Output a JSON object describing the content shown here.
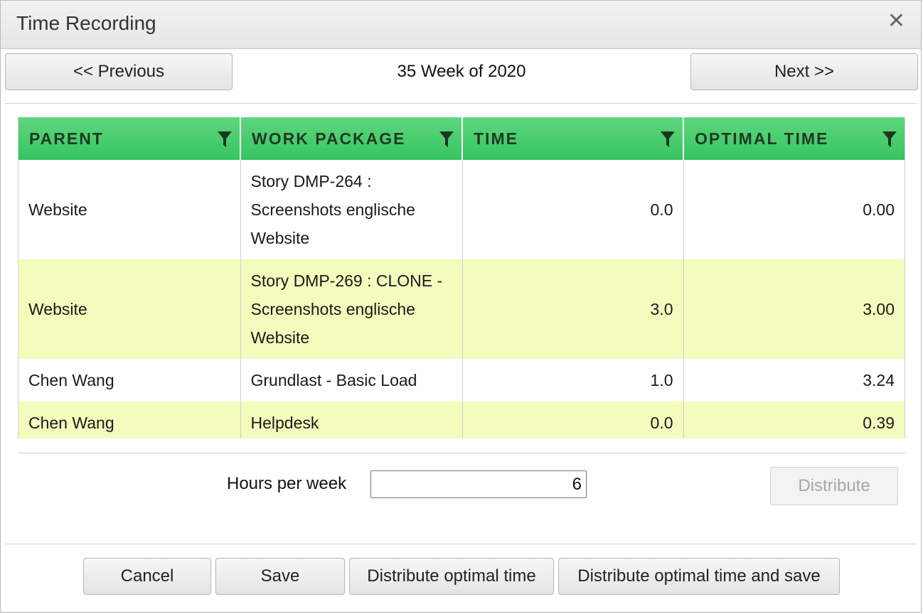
{
  "dialog": {
    "title": "Time Recording",
    "close_icon": "close-icon"
  },
  "nav": {
    "previous_label": "<< Previous",
    "week_label": "35 Week of 2020",
    "next_label": "Next >>"
  },
  "table": {
    "columns": [
      "PARENT",
      "WORK PACKAGE",
      "TIME",
      "OPTIMAL TIME"
    ],
    "header_color": "#3ec865",
    "alt_row_color": "#f3fcbd",
    "rows": [
      {
        "parent": "Website",
        "work_package": "Story DMP-264 : Screenshots englische Website",
        "time": "0.0",
        "optimal_time": "0.00"
      },
      {
        "parent": "Website",
        "work_package": "Story DMP-269 : CLONE - Screenshots englische Website",
        "time": "3.0",
        "optimal_time": "3.00"
      },
      {
        "parent": "Chen Wang",
        "work_package": "Grundlast - Basic Load",
        "time": "1.0",
        "optimal_time": "3.24"
      },
      {
        "parent": "Chen Wang",
        "work_package": "Helpdesk",
        "time": "0.0",
        "optimal_time": "0.39"
      }
    ]
  },
  "hours": {
    "label": "Hours per week",
    "value": "6",
    "distribute_label": "Distribute"
  },
  "footer": {
    "cancel_label": "Cancel",
    "save_label": "Save",
    "distribute_optimal_label": "Distribute optimal time",
    "distribute_optimal_save_label": "Distribute optimal time and save"
  }
}
